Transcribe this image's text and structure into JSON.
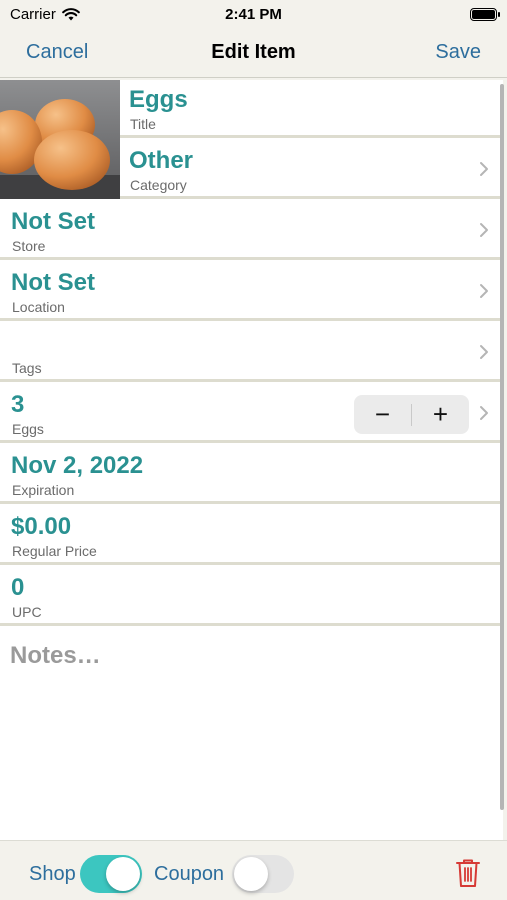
{
  "status_bar": {
    "carrier": "Carrier",
    "time": "2:41 PM"
  },
  "nav": {
    "cancel": "Cancel",
    "title": "Edit Item",
    "save": "Save"
  },
  "fields": {
    "title": {
      "value": "Eggs",
      "label": "Title"
    },
    "category": {
      "value": "Other",
      "label": "Category"
    },
    "store": {
      "value": "Not Set",
      "label": "Store"
    },
    "location": {
      "value": "Not Set",
      "label": "Location"
    },
    "tags": {
      "value": "",
      "label": "Tags"
    },
    "quantity": {
      "value": "3",
      "label": "Eggs",
      "minus": "−",
      "plus": "+"
    },
    "expiration": {
      "value": "Nov 2, 2022",
      "label": "Expiration"
    },
    "price": {
      "value": "$0.00",
      "label": "Regular Price"
    },
    "upc": {
      "value": "0",
      "label": "UPC"
    }
  },
  "notes": {
    "placeholder": "Notes…"
  },
  "toolbar": {
    "shop_label": "Shop",
    "shop_on": true,
    "coupon_label": "Coupon",
    "coupon_on": false
  },
  "colors": {
    "accent": "#2a9191",
    "link": "#2d6e9d",
    "toggle_on": "#3cc6c0",
    "delete": "#d63a35"
  },
  "icons": [
    "wifi-icon",
    "battery-icon",
    "chevron-right-icon",
    "trash-icon"
  ]
}
